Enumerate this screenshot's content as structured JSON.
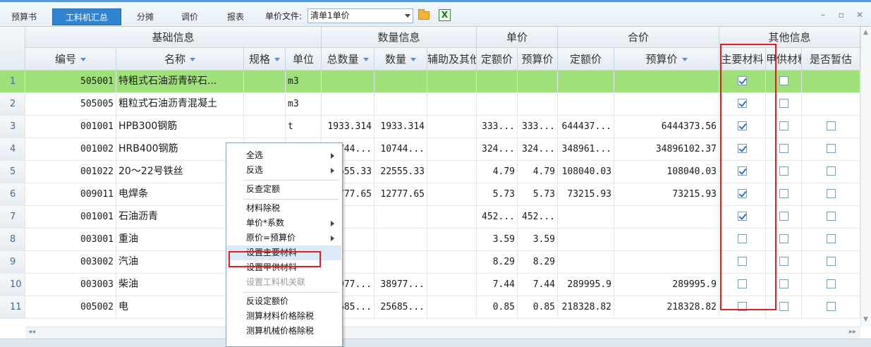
{
  "toolbar": {
    "tabs": [
      {
        "label": "预算书",
        "active": false
      },
      {
        "label": "工料机汇总",
        "active": true
      },
      {
        "label": "分摊",
        "active": false
      },
      {
        "label": "调价",
        "active": false
      },
      {
        "label": "报表",
        "active": false
      }
    ],
    "unit_price_file_label": "单价文件:",
    "unit_price_file_value": "清单1单价",
    "window_minimize": "–",
    "window_restore": "▫",
    "window_close": "✕"
  },
  "grid": {
    "groups": [
      "基础信息",
      "数量信息",
      "单价",
      "合价",
      "其他信息"
    ],
    "columns": [
      "编号",
      "名称",
      "规格",
      "单位",
      "总数量",
      "数量",
      "辅助及其他",
      "定额价",
      "预算价",
      "定额价",
      "预算价",
      "主要材料",
      "甲供材料",
      "是否暂估"
    ],
    "rows": [
      {
        "n": "1",
        "code": "505001",
        "name": "特粗式石油沥青碎石...",
        "spec": "",
        "unit": "m3",
        "total_qty": "",
        "qty": "",
        "aux": "",
        "u_quota": "",
        "u_budget": "",
        "t_quota": "",
        "t_budget": "",
        "main": true,
        "supply": false,
        "est": null,
        "selected": true
      },
      {
        "n": "2",
        "code": "505005",
        "name": "粗粒式石油沥青混凝土",
        "spec": "",
        "unit": "m3",
        "total_qty": "",
        "qty": "",
        "aux": "",
        "u_quota": "",
        "u_budget": "",
        "t_quota": "",
        "t_budget": "",
        "main": true,
        "supply": false,
        "est": null,
        "selected": false
      },
      {
        "n": "3",
        "code": "001001",
        "name": "HPB300钢筋",
        "spec": "",
        "unit": "t",
        "total_qty": "1933.314",
        "qty": "1933.314",
        "aux": "",
        "u_quota": "333...",
        "u_budget": "333...",
        "t_quota": "644437...",
        "t_budget": "6444373.56",
        "main": true,
        "supply": false,
        "est": false,
        "selected": false
      },
      {
        "n": "4",
        "code": "001002",
        "name": "HRB400钢筋",
        "spec": "",
        "unit": "",
        "total_qty": "744...",
        "qty": "10744...",
        "aux": "",
        "u_quota": "324...",
        "u_budget": "324...",
        "t_quota": "348961...",
        "t_budget": "34896102.37",
        "main": true,
        "supply": false,
        "est": false,
        "selected": false
      },
      {
        "n": "5",
        "code": "001022",
        "name": "20～22号铁丝",
        "spec": "",
        "unit": "",
        "total_qty": "555.33",
        "qty": "22555.33",
        "aux": "",
        "u_quota": "4.79",
        "u_budget": "4.79",
        "t_quota": "108040.03",
        "t_budget": "108040.03",
        "main": true,
        "supply": false,
        "est": false,
        "selected": false
      },
      {
        "n": "6",
        "code": "009011",
        "name": "电焊条",
        "spec": "",
        "unit": "",
        "total_qty": "777.65",
        "qty": "12777.65",
        "aux": "",
        "u_quota": "5.73",
        "u_budget": "5.73",
        "t_quota": "73215.93",
        "t_budget": "73215.93",
        "main": true,
        "supply": false,
        "est": false,
        "selected": false
      },
      {
        "n": "7",
        "code": "001001",
        "name": "石油沥青",
        "spec": "",
        "unit": "",
        "total_qty": "",
        "qty": "",
        "aux": "",
        "u_quota": "452...",
        "u_budget": "452...",
        "t_quota": "",
        "t_budget": "",
        "main": true,
        "supply": false,
        "est": false,
        "selected": false
      },
      {
        "n": "8",
        "code": "003001",
        "name": "重油",
        "spec": "",
        "unit": "",
        "total_qty": "",
        "qty": "",
        "aux": "",
        "u_quota": "3.59",
        "u_budget": "3.59",
        "t_quota": "",
        "t_budget": "",
        "main": false,
        "supply": false,
        "est": false,
        "selected": false
      },
      {
        "n": "9",
        "code": "003002",
        "name": "汽油",
        "spec": "",
        "unit": "",
        "total_qty": "",
        "qty": "",
        "aux": "",
        "u_quota": "8.29",
        "u_budget": "8.29",
        "t_quota": "",
        "t_budget": "",
        "main": false,
        "supply": false,
        "est": false,
        "selected": false
      },
      {
        "n": "10",
        "code": "003003",
        "name": "柴油",
        "spec": "",
        "unit": "",
        "total_qty": "977...",
        "qty": "38977...",
        "aux": "",
        "u_quota": "7.44",
        "u_budget": "7.44",
        "t_quota": "289995.9",
        "t_budget": "289995.9",
        "main": false,
        "supply": false,
        "est": false,
        "selected": false
      },
      {
        "n": "11",
        "code": "005002",
        "name": "电",
        "spec": "",
        "unit": "",
        "total_qty": "685...",
        "qty": "25685...",
        "aux": "",
        "u_quota": "0.85",
        "u_budget": "0.85",
        "t_quota": "218328.82",
        "t_budget": "218328.82",
        "main": false,
        "supply": false,
        "est": false,
        "selected": false
      }
    ]
  },
  "context_menu": {
    "items": [
      {
        "label": "全选",
        "submenu": true,
        "disabled": false
      },
      {
        "label": "反选",
        "submenu": true,
        "disabled": false
      },
      {
        "sep": true
      },
      {
        "label": "反查定额",
        "submenu": false,
        "disabled": false
      },
      {
        "sep": true
      },
      {
        "label": "材料除税",
        "submenu": false,
        "disabled": false
      },
      {
        "label": "单价*系数",
        "submenu": true,
        "disabled": false
      },
      {
        "label": "原价=预算价",
        "submenu": true,
        "disabled": false
      },
      {
        "label": "设置主要材料",
        "submenu": false,
        "disabled": false,
        "highlighted": true
      },
      {
        "label": "设置甲供材料",
        "submenu": false,
        "disabled": false
      },
      {
        "label": "设置工料机关联",
        "submenu": false,
        "disabled": true
      },
      {
        "sep": true
      },
      {
        "label": "反设定额价",
        "submenu": false,
        "disabled": false
      },
      {
        "label": "测算材料价格除税",
        "submenu": false,
        "disabled": false
      },
      {
        "label": "测算机械价格除税",
        "submenu": false,
        "disabled": false
      }
    ]
  },
  "colors": {
    "selected_row": "#9fe07a",
    "active_tab": "#2f83d0",
    "highlight_box": "#e02020"
  }
}
